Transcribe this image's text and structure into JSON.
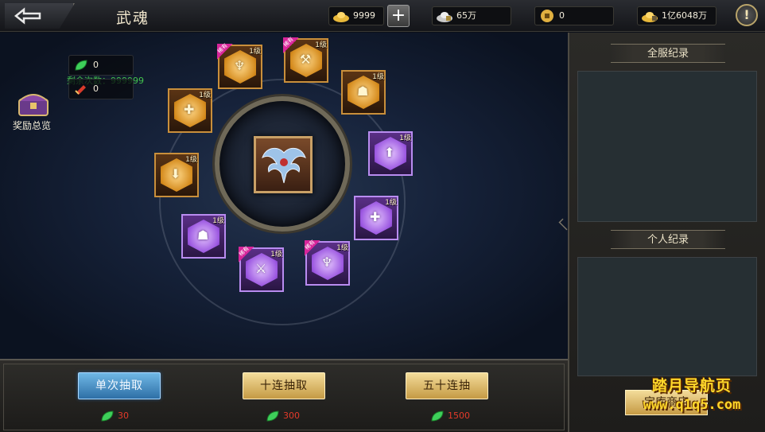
{
  "header": {
    "title": "武魂",
    "ingot": "9999",
    "silver": "65万",
    "coin": "0",
    "power": "1亿6048万",
    "info_glyph": "!"
  },
  "left_panel": {
    "remaining": "剩余次数：999999",
    "reward_overview": "奖励总览",
    "counter_green": "0",
    "counter_red": "0"
  },
  "gems": [
    {
      "color": "gold",
      "level": "1级",
      "rare": true,
      "rare_label": "稀有",
      "glyph": "♆"
    },
    {
      "color": "gold",
      "level": "1级",
      "rare": true,
      "rare_label": "稀有",
      "glyph": "⚒"
    },
    {
      "color": "gold",
      "level": "1级",
      "rare": false,
      "glyph": "☗"
    },
    {
      "color": "gold",
      "level": "1级",
      "rare": false,
      "glyph": "✚"
    },
    {
      "color": "purple",
      "level": "1级",
      "rare": false,
      "glyph": "⬆"
    },
    {
      "color": "gold",
      "level": "1级",
      "rare": false,
      "glyph": "⬇"
    },
    {
      "color": "purple",
      "level": "1级",
      "rare": false,
      "glyph": "✚"
    },
    {
      "color": "purple",
      "level": "1级",
      "rare": false,
      "glyph": "☗"
    },
    {
      "color": "purple",
      "level": "1级",
      "rare": true,
      "rare_label": "稀有",
      "glyph": "♆"
    },
    {
      "color": "purple",
      "level": "1级",
      "rare": true,
      "rare_label": "稀有",
      "glyph": "⚔"
    }
  ],
  "draw": {
    "single": "单次抽取",
    "ten": "十连抽取",
    "fifty": "五十连抽",
    "single_cost": "30",
    "ten_cost": "300",
    "fifty_cost": "1500"
  },
  "right_panel": {
    "server_records": "全服纪录",
    "personal_records": "个人纪录",
    "shop": "宝库商店"
  },
  "watermark": {
    "line1": "踏月导航页",
    "line2": "www.q1q5.com"
  },
  "colors": {
    "gold_frame": "#c98f3b",
    "purple_frame": "#b98cf0",
    "cost_red": "#e43a2a",
    "remain_green": "#42c24d"
  }
}
